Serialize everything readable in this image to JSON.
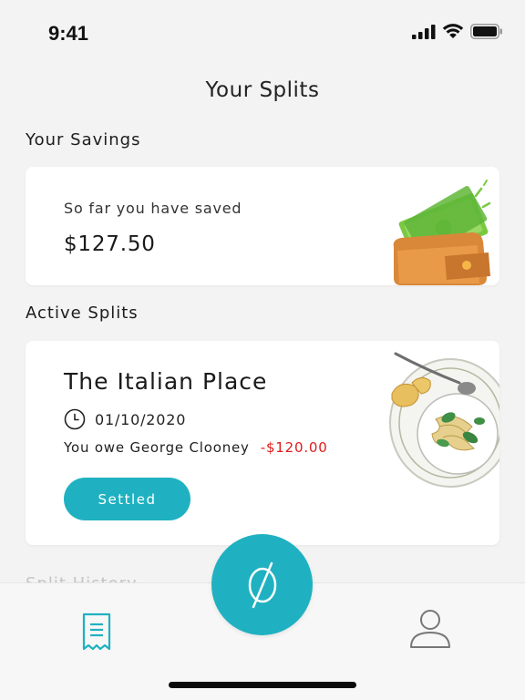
{
  "status_bar": {
    "time": "9:41"
  },
  "header": {
    "title": "Your Splits"
  },
  "savings": {
    "section_title": "Your Savings",
    "label": "So far you have saved",
    "amount": "$127.50"
  },
  "active_splits": {
    "section_title": "Active Splits",
    "items": [
      {
        "name": "The Italian Place",
        "date": "01/10/2020",
        "owe_text": "You owe George Clooney",
        "amount": "-$120.00",
        "button_label": "Settled"
      }
    ]
  },
  "split_history": {
    "section_title": "Split History"
  },
  "colors": {
    "accent": "#1fb1c1",
    "negative": "#e01b1b",
    "background": "#f3f3f3"
  },
  "icons": [
    "signal-icon",
    "wifi-icon",
    "battery-icon",
    "clock-icon",
    "receipt-icon",
    "split-icon",
    "profile-icon"
  ]
}
